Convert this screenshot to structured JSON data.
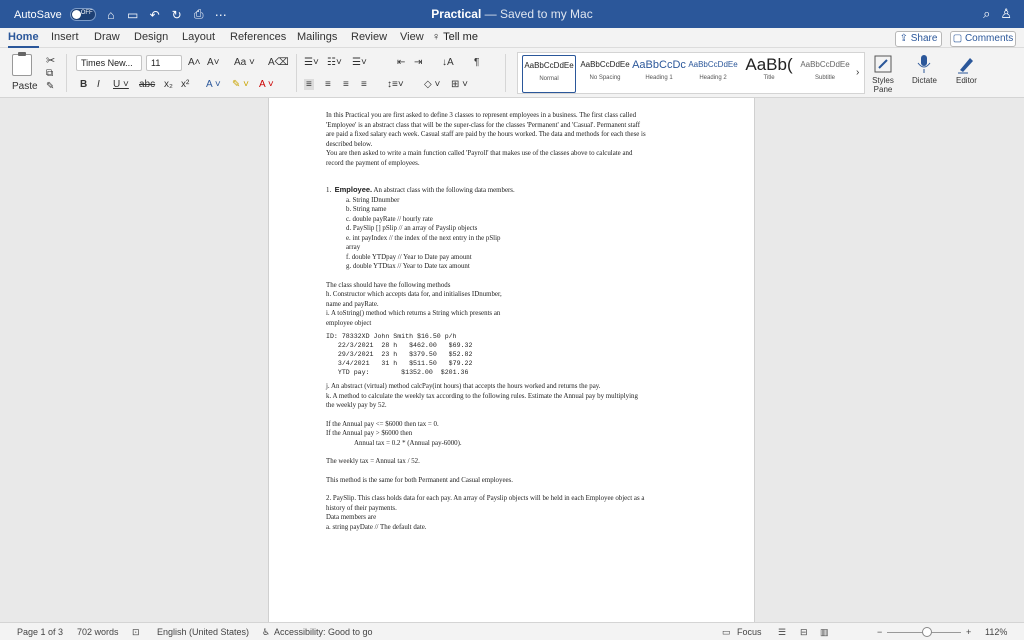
{
  "titlebar": {
    "autosave": "AutoSave",
    "toggle_state": "OFF",
    "doc_title": "Practical",
    "saved_status": "— Saved to my Mac"
  },
  "tabs": [
    "Home",
    "Insert",
    "Draw",
    "Design",
    "Layout",
    "References",
    "Mailings",
    "Review",
    "View"
  ],
  "active_tab": "Home",
  "tell_me": "Tell me",
  "share": "Share",
  "comments": "Comments",
  "ribbon": {
    "paste": "Paste",
    "font_name": "Times New...",
    "font_size": "11",
    "styles": [
      {
        "preview": "AaBbCcDdEe",
        "name": "Normal"
      },
      {
        "preview": "AaBbCcDdEe",
        "name": "No Spacing"
      },
      {
        "preview": "AaBbCcDc",
        "name": "Heading 1"
      },
      {
        "preview": "AaBbCcDdEe",
        "name": "Heading 2"
      },
      {
        "preview": "AaBb(",
        "name": "Title"
      },
      {
        "preview": "AaBbCcDdEe",
        "name": "Subtitle"
      }
    ],
    "styles_pane": "Styles Pane",
    "dictate": "Dictate",
    "editor": "Editor"
  },
  "document": {
    "intro1": "In this Practical you are first asked to define 3 classes to represent employees in a business. The first class called 'Employee' is an abstract class that will be the super-class for the classes 'Permanent' and 'Casual'. Permanent staff are paid a fixed salary each week. Casual staff are paid by the hours worked. The data and methods for each these is described below.",
    "intro2": "You are then asked to write a main function called 'Payroll' that makes use of the classes above to calculate and record the payment of employees.",
    "item1_num": "1.",
    "item1_title": "Employee.",
    "item1_text": "An abstract class with the following data members.",
    "members": [
      "a. String IDnumber",
      "b. String name",
      "c. double payRate // hourly rate",
      "d. PaySlip [] pSlip // an array of Payslip objects",
      "e. int payIndex // the index of the next entry in the pSlip",
      "array",
      "f. double YTDpay // Year to Date pay amount",
      "g. double YTDtax // Year to Date tax amount"
    ],
    "methods_intro": "The class should have the following methods",
    "method_h": "h. Constructor which accepts data for, and initialises IDnumber,",
    "method_h2": "name and payRate.",
    "method_i": "i. A toString() method which returns a String which presents an",
    "method_i2": "employee object",
    "sample": [
      "ID: 78332XD John Smith $16.50 p/h",
      "   22/3/2021  28 h   $462.00   $69.32",
      "   29/3/2021  23 h   $379.50   $52.82",
      "   3/4/2021   31 h   $511.50   $79.22",
      "   YTD pay:        $1352.00  $201.36"
    ],
    "method_j": "j. An abstract (virtual) method calcPay(int hours) that accepts the hours worked and returns the pay.",
    "method_k": "k. A method to calculate the weekly tax according to the following rules. Estimate the Annual pay by multiplying the weekly pay by 52.",
    "rule1": "If the Annual pay <= $6000 then tax = 0.",
    "rule2": "If the Annual pay > $6000 then",
    "rule3": "Annual tax = 0.2 * (Annual pay-6000).",
    "weekly": "The weekly tax = Annual tax / 52.",
    "same": "This method is the same for both Permanent and Casual employees.",
    "item2": "2. PaySlip. This class holds data for each pay. An array of Payslip objects will be held in each Employee object as a history of their payments.",
    "item2_b": "Data members are",
    "item2_c": "a. string payDate // The default date."
  },
  "status": {
    "page": "Page 1 of 3",
    "words": "702 words",
    "language": "English (United States)",
    "accessibility": "Accessibility: Good to go",
    "focus": "Focus",
    "zoom": "112%"
  }
}
